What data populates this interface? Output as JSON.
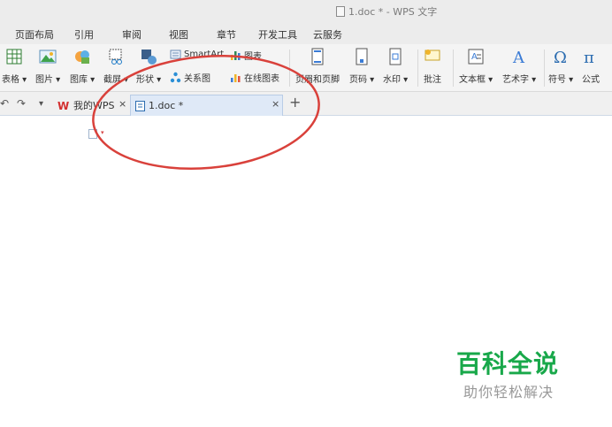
{
  "window": {
    "title": "1.doc * - WPS 文字"
  },
  "menu": [
    "页面布局",
    "引用",
    "审阅",
    "视图",
    "章节",
    "开发工具",
    "云服务"
  ],
  "ribbon": {
    "table": "表格 ▾",
    "picture": "图片 ▾",
    "gallery": "图库 ▾",
    "screenshot": "截屏 ▾",
    "shape": "形状 ▾",
    "smartart": "SmartArt",
    "chart": "图表",
    "relation": "关系图",
    "online_chart": "在线图表",
    "header_footer": "页眉和页脚",
    "page_number": "页码 ▾",
    "watermark": "水印 ▾",
    "comment": "批注",
    "textbox": "文本框 ▾",
    "wordart": "艺术字 ▾",
    "symbol": "符号 ▾",
    "formula": "公式"
  },
  "tabs": {
    "home_label": "我的WPS",
    "doc_label": "1.doc *",
    "close": "×",
    "add": "+"
  },
  "quick_access": {
    "redo": "↷",
    "undo": "↶",
    "dropdown": "▾"
  },
  "watermark": {
    "title": "百科全说",
    "subtitle": "助你轻松解决"
  },
  "colors": {
    "annotation": "#d9413b",
    "watermark_title": "#18a84a",
    "active_tab": "#dfe9f7"
  }
}
